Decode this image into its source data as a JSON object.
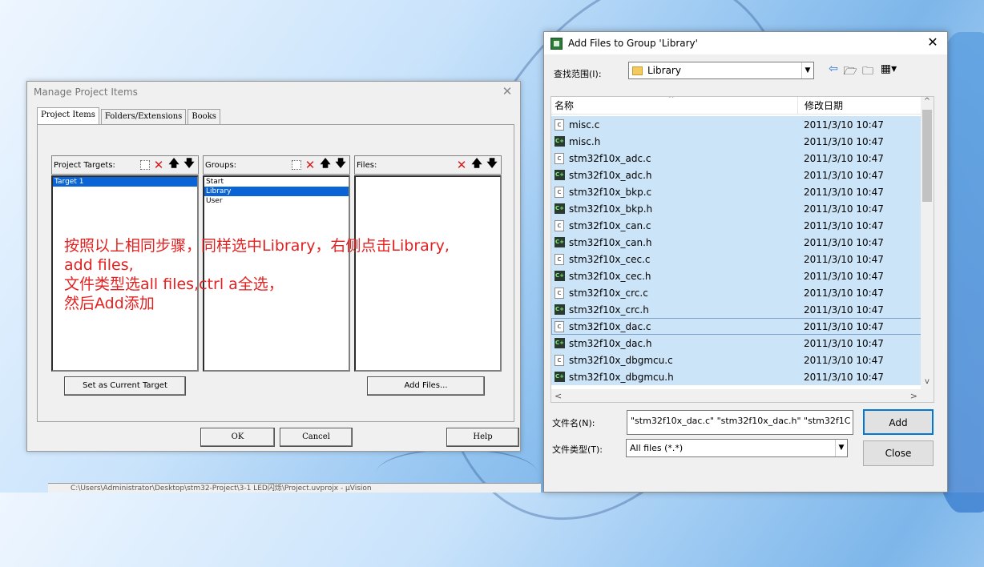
{
  "manage_dialog": {
    "title": "Manage Project Items",
    "close_glyph": "✕",
    "tabs": [
      {
        "label": "Project Items",
        "active": true
      },
      {
        "label": "Folders/Extensions",
        "active": false
      },
      {
        "label": "Books",
        "active": false
      }
    ],
    "project_targets": {
      "label": "Project Targets:",
      "items": [
        "Target 1"
      ],
      "selected": 0
    },
    "groups": {
      "label": "Groups:",
      "items": [
        "Start",
        "Library",
        "User"
      ],
      "selected": 1
    },
    "files": {
      "label": "Files:",
      "items": []
    },
    "set_target_button": "Set as Current Target",
    "add_files_button": "Add Files...",
    "ok_button": "OK",
    "cancel_button": "Cancel",
    "help_button": "Help"
  },
  "annotation": {
    "lines": [
      "按照以上相同步骤，同样选中Library，右侧点击Library,",
      "add files,",
      "文件类型选all files,ctrl a全选，",
      "然后Add添加"
    ],
    "color": "#e42121"
  },
  "add_files_dialog": {
    "title": "Add Files to Group 'Library'",
    "close_glyph": "✕",
    "look_in_label": "查找范围(I):",
    "look_in_value": "Library",
    "columns": {
      "name": "名称",
      "date": "修改日期"
    },
    "files": [
      {
        "name": "misc.c",
        "type": "c",
        "date": "2011/3/10 10:47"
      },
      {
        "name": "misc.h",
        "type": "h",
        "date": "2011/3/10 10:47"
      },
      {
        "name": "stm32f10x_adc.c",
        "type": "c",
        "date": "2011/3/10 10:47"
      },
      {
        "name": "stm32f10x_adc.h",
        "type": "h",
        "date": "2011/3/10 10:47"
      },
      {
        "name": "stm32f10x_bkp.c",
        "type": "c",
        "date": "2011/3/10 10:47"
      },
      {
        "name": "stm32f10x_bkp.h",
        "type": "h",
        "date": "2011/3/10 10:47"
      },
      {
        "name": "stm32f10x_can.c",
        "type": "c",
        "date": "2011/3/10 10:47"
      },
      {
        "name": "stm32f10x_can.h",
        "type": "h",
        "date": "2011/3/10 10:47"
      },
      {
        "name": "stm32f10x_cec.c",
        "type": "c",
        "date": "2011/3/10 10:47"
      },
      {
        "name": "stm32f10x_cec.h",
        "type": "h",
        "date": "2011/3/10 10:47"
      },
      {
        "name": "stm32f10x_crc.c",
        "type": "c",
        "date": "2011/3/10 10:47"
      },
      {
        "name": "stm32f10x_crc.h",
        "type": "h",
        "date": "2011/3/10 10:47"
      },
      {
        "name": "stm32f10x_dac.c",
        "type": "c",
        "date": "2011/3/10 10:47",
        "focus": true
      },
      {
        "name": "stm32f10x_dac.h",
        "type": "h",
        "date": "2011/3/10 10:47"
      },
      {
        "name": "stm32f10x_dbgmcu.c",
        "type": "c",
        "date": "2011/3/10 10:47"
      },
      {
        "name": "stm32f10x_dbgmcu.h",
        "type": "h",
        "date": "2011/3/10 10:47"
      }
    ],
    "file_name_label": "文件名(N):",
    "file_name_value": "\"stm32f10x_dac.c\" \"stm32f10x_dac.h\" \"stm32f1C",
    "file_type_label": "文件类型(T):",
    "file_type_value": "All files (*.*)",
    "add_button": "Add",
    "close_button": "Close",
    "selection_color": "#cce4f7"
  },
  "taskbar_text": "C:\\Users\\Administrator\\Desktop\\stm32-Project\\3-1 LED闪烁\\Project.uvprojx - µVision"
}
